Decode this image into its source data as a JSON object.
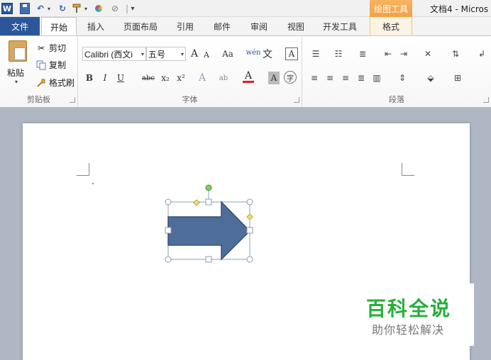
{
  "title_bar": {
    "app_icon_letter": "W",
    "context_tab_title": "绘图工具",
    "window_title": "文档4 - Micros"
  },
  "tabs": [
    {
      "label": "文件"
    },
    {
      "label": "开始"
    },
    {
      "label": "插入"
    },
    {
      "label": "页面布局"
    },
    {
      "label": "引用"
    },
    {
      "label": "邮件"
    },
    {
      "label": "审阅"
    },
    {
      "label": "视图"
    },
    {
      "label": "开发工具"
    },
    {
      "label": "格式"
    }
  ],
  "ribbon": {
    "clipboard": {
      "paste": "粘贴",
      "cut": "剪切",
      "copy": "复制",
      "format_painter": "格式刷",
      "label": "剪贴板"
    },
    "font": {
      "font_name": "Calibri (西文i",
      "font_size": "五号",
      "grow": "A",
      "shrink": "A",
      "change_case": "Aa",
      "clear_format": "A",
      "bold": "B",
      "italic": "I",
      "underline": "U",
      "strike": "abc",
      "subscript": "x₂",
      "superscript": "x²",
      "highlight": "ab",
      "font_color": "A",
      "char_shade": "A",
      "enclose": "字",
      "phonetic": "wén",
      "phonetic_char": "文",
      "border": "A",
      "label": "字体"
    },
    "paragraph": {
      "label": "段落"
    }
  },
  "watermark": {
    "title": "百科全说",
    "subtitle": "助你轻松解决"
  },
  "colors": {
    "file_tab": "#2b579a",
    "context_tab": "#f1a245",
    "shape_fill": "#4f6d99",
    "watermark_green": "#27ae3b"
  }
}
